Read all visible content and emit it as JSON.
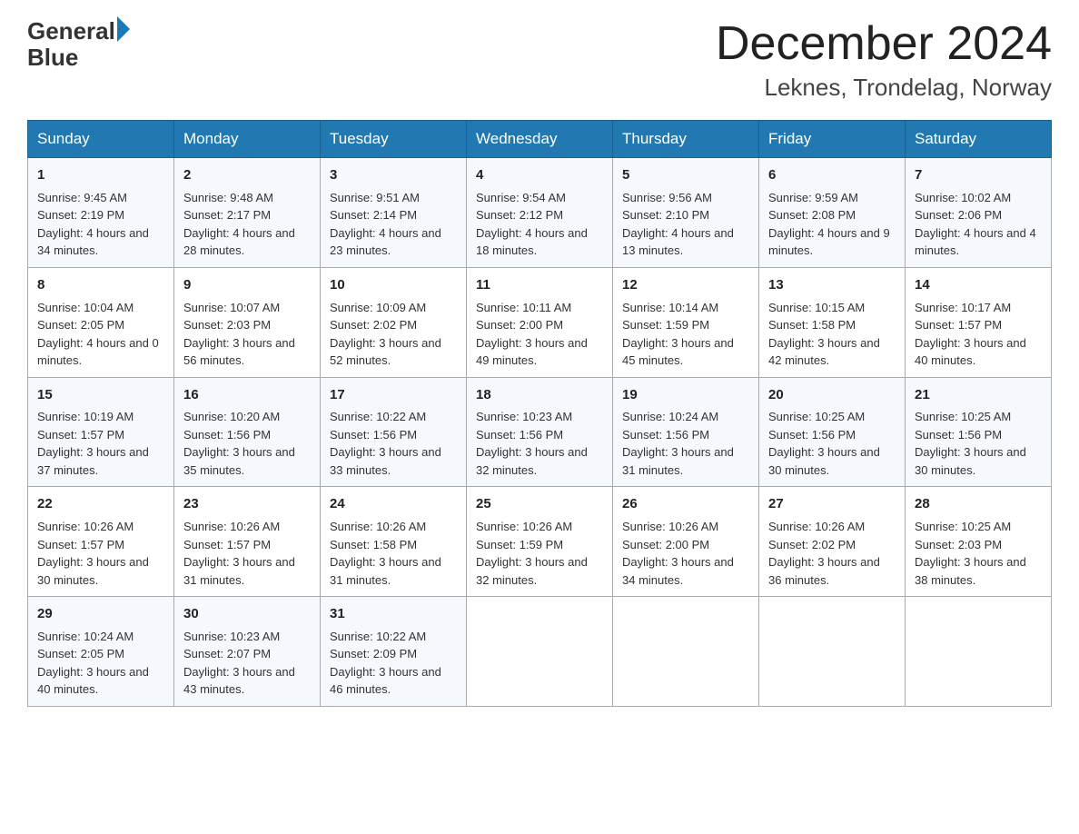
{
  "header": {
    "logo_general": "General",
    "logo_blue": "Blue",
    "month_title": "December 2024",
    "location": "Leknes, Trondelag, Norway"
  },
  "days_of_week": [
    "Sunday",
    "Monday",
    "Tuesday",
    "Wednesday",
    "Thursday",
    "Friday",
    "Saturday"
  ],
  "weeks": [
    [
      {
        "day": "1",
        "sunrise": "9:45 AM",
        "sunset": "2:19 PM",
        "daylight": "4 hours and 34 minutes."
      },
      {
        "day": "2",
        "sunrise": "9:48 AM",
        "sunset": "2:17 PM",
        "daylight": "4 hours and 28 minutes."
      },
      {
        "day": "3",
        "sunrise": "9:51 AM",
        "sunset": "2:14 PM",
        "daylight": "4 hours and 23 minutes."
      },
      {
        "day": "4",
        "sunrise": "9:54 AM",
        "sunset": "2:12 PM",
        "daylight": "4 hours and 18 minutes."
      },
      {
        "day": "5",
        "sunrise": "9:56 AM",
        "sunset": "2:10 PM",
        "daylight": "4 hours and 13 minutes."
      },
      {
        "day": "6",
        "sunrise": "9:59 AM",
        "sunset": "2:08 PM",
        "daylight": "4 hours and 9 minutes."
      },
      {
        "day": "7",
        "sunrise": "10:02 AM",
        "sunset": "2:06 PM",
        "daylight": "4 hours and 4 minutes."
      }
    ],
    [
      {
        "day": "8",
        "sunrise": "10:04 AM",
        "sunset": "2:05 PM",
        "daylight": "4 hours and 0 minutes."
      },
      {
        "day": "9",
        "sunrise": "10:07 AM",
        "sunset": "2:03 PM",
        "daylight": "3 hours and 56 minutes."
      },
      {
        "day": "10",
        "sunrise": "10:09 AM",
        "sunset": "2:02 PM",
        "daylight": "3 hours and 52 minutes."
      },
      {
        "day": "11",
        "sunrise": "10:11 AM",
        "sunset": "2:00 PM",
        "daylight": "3 hours and 49 minutes."
      },
      {
        "day": "12",
        "sunrise": "10:14 AM",
        "sunset": "1:59 PM",
        "daylight": "3 hours and 45 minutes."
      },
      {
        "day": "13",
        "sunrise": "10:15 AM",
        "sunset": "1:58 PM",
        "daylight": "3 hours and 42 minutes."
      },
      {
        "day": "14",
        "sunrise": "10:17 AM",
        "sunset": "1:57 PM",
        "daylight": "3 hours and 40 minutes."
      }
    ],
    [
      {
        "day": "15",
        "sunrise": "10:19 AM",
        "sunset": "1:57 PM",
        "daylight": "3 hours and 37 minutes."
      },
      {
        "day": "16",
        "sunrise": "10:20 AM",
        "sunset": "1:56 PM",
        "daylight": "3 hours and 35 minutes."
      },
      {
        "day": "17",
        "sunrise": "10:22 AM",
        "sunset": "1:56 PM",
        "daylight": "3 hours and 33 minutes."
      },
      {
        "day": "18",
        "sunrise": "10:23 AM",
        "sunset": "1:56 PM",
        "daylight": "3 hours and 32 minutes."
      },
      {
        "day": "19",
        "sunrise": "10:24 AM",
        "sunset": "1:56 PM",
        "daylight": "3 hours and 31 minutes."
      },
      {
        "day": "20",
        "sunrise": "10:25 AM",
        "sunset": "1:56 PM",
        "daylight": "3 hours and 30 minutes."
      },
      {
        "day": "21",
        "sunrise": "10:25 AM",
        "sunset": "1:56 PM",
        "daylight": "3 hours and 30 minutes."
      }
    ],
    [
      {
        "day": "22",
        "sunrise": "10:26 AM",
        "sunset": "1:57 PM",
        "daylight": "3 hours and 30 minutes."
      },
      {
        "day": "23",
        "sunrise": "10:26 AM",
        "sunset": "1:57 PM",
        "daylight": "3 hours and 31 minutes."
      },
      {
        "day": "24",
        "sunrise": "10:26 AM",
        "sunset": "1:58 PM",
        "daylight": "3 hours and 31 minutes."
      },
      {
        "day": "25",
        "sunrise": "10:26 AM",
        "sunset": "1:59 PM",
        "daylight": "3 hours and 32 minutes."
      },
      {
        "day": "26",
        "sunrise": "10:26 AM",
        "sunset": "2:00 PM",
        "daylight": "3 hours and 34 minutes."
      },
      {
        "day": "27",
        "sunrise": "10:26 AM",
        "sunset": "2:02 PM",
        "daylight": "3 hours and 36 minutes."
      },
      {
        "day": "28",
        "sunrise": "10:25 AM",
        "sunset": "2:03 PM",
        "daylight": "3 hours and 38 minutes."
      }
    ],
    [
      {
        "day": "29",
        "sunrise": "10:24 AM",
        "sunset": "2:05 PM",
        "daylight": "3 hours and 40 minutes."
      },
      {
        "day": "30",
        "sunrise": "10:23 AM",
        "sunset": "2:07 PM",
        "daylight": "3 hours and 43 minutes."
      },
      {
        "day": "31",
        "sunrise": "10:22 AM",
        "sunset": "2:09 PM",
        "daylight": "3 hours and 46 minutes."
      },
      null,
      null,
      null,
      null
    ]
  ],
  "labels": {
    "sunrise": "Sunrise:",
    "sunset": "Sunset:",
    "daylight": "Daylight:"
  }
}
